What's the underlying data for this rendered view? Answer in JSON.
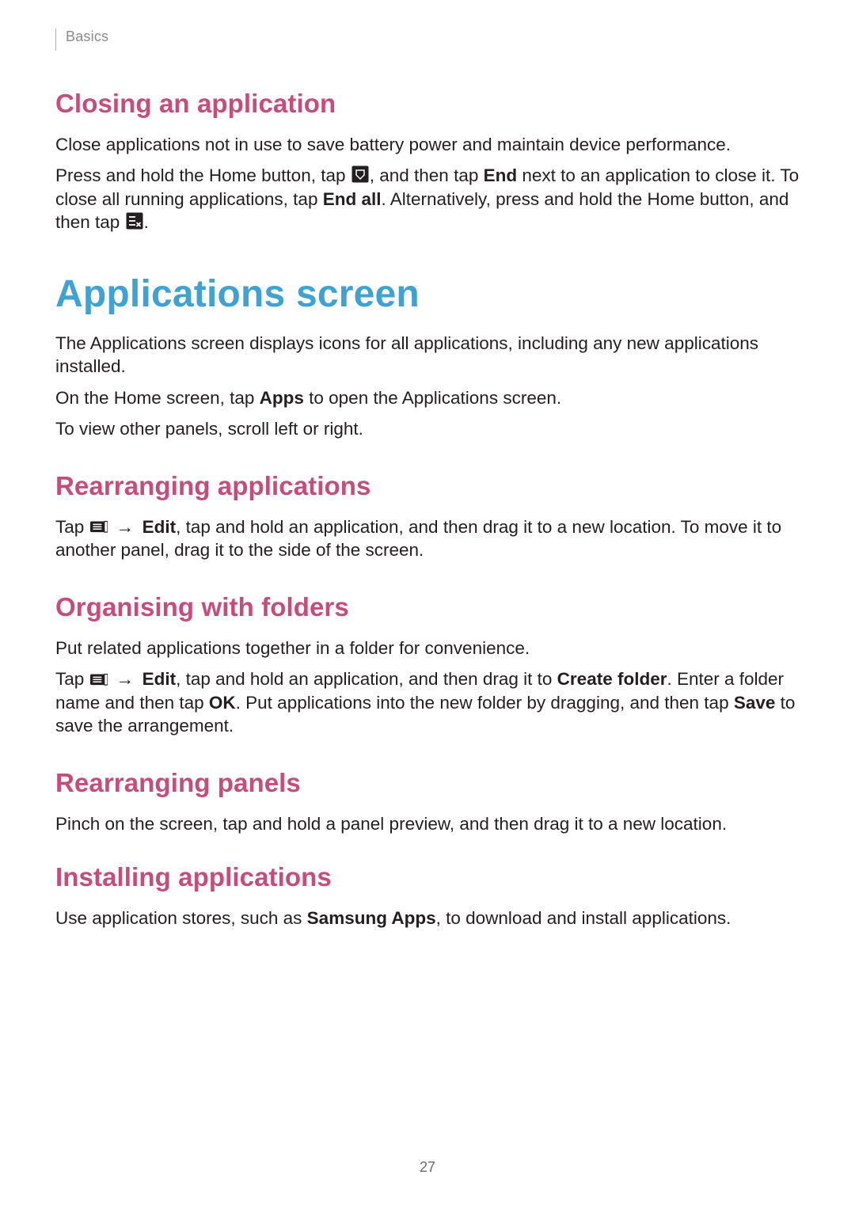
{
  "breadcrumb": "Basics",
  "page_number": "27",
  "closing_app": {
    "heading": "Closing an application",
    "p1": "Close applications not in use to save battery power and maintain device performance.",
    "p2a": "Press and hold the Home button, tap ",
    "p2b": ", and then tap ",
    "p2c_bold": "End",
    "p2d": " next to an application to close it. To close all running applications, tap ",
    "p2e_bold": "End all",
    "p2f": ". Alternatively, press and hold the Home button, and then tap ",
    "p2g": "."
  },
  "apps_screen": {
    "heading": "Applications screen",
    "p1": "The Applications screen displays icons for all applications, including any new applications installed.",
    "p2a": "On the Home screen, tap ",
    "p2b_bold": "Apps",
    "p2c": " to open the Applications screen.",
    "p3": "To view other panels, scroll left or right."
  },
  "rearranging_apps": {
    "heading": "Rearranging applications",
    "p1a": "Tap ",
    "arrow": "→",
    "p1b_bold": "Edit",
    "p1c": ", tap and hold an application, and then drag it to a new location. To move it to another panel, drag it to the side of the screen."
  },
  "organising": {
    "heading": "Organising with folders",
    "p1": "Put related applications together in a folder for convenience.",
    "p2a": "Tap ",
    "arrow": "→",
    "p2b_bold": "Edit",
    "p2c": ", tap and hold an application, and then drag it to ",
    "p2d_bold": "Create folder",
    "p2e": ". Enter a folder name and then tap ",
    "p2f_bold": "OK",
    "p2g": ". Put applications into the new folder by dragging, and then tap ",
    "p2h_bold": "Save",
    "p2i": " to save the arrangement."
  },
  "rearranging_panels": {
    "heading": "Rearranging panels",
    "p1": "Pinch on the screen, tap and hold a panel preview, and then drag it to a new location."
  },
  "installing": {
    "heading": "Installing applications",
    "p1a": "Use application stores, such as ",
    "p1b_bold": "Samsung Apps",
    "p1c": ", to download and install applications."
  }
}
